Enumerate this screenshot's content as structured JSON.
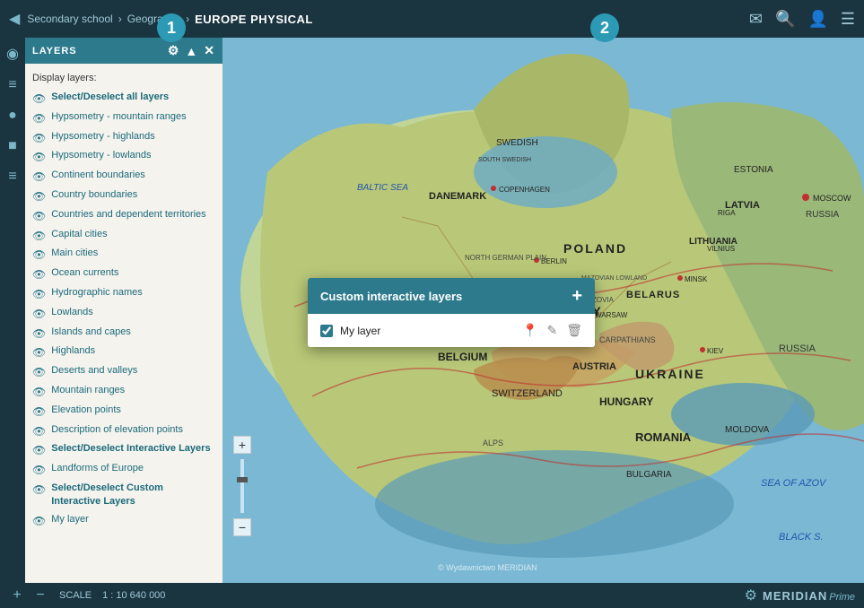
{
  "header": {
    "nav_back": "◀",
    "breadcrumb": {
      "part1": "Secondary school",
      "sep1": "›",
      "part2": "Geography",
      "sep2": "›",
      "current": "EUROPE PHYSICAL"
    },
    "icons": {
      "mail": "✉",
      "search": "🔍",
      "user": "👤",
      "menu": "☰"
    }
  },
  "left_toolbar": {
    "icons": [
      "◉",
      "≡",
      "📍",
      "⊞",
      "☰"
    ]
  },
  "sidebar": {
    "header_label": "LAYERS",
    "display_layers_label": "Display layers:",
    "layers": [
      {
        "text": "Select/Deselect all layers",
        "bold": true
      },
      {
        "text": "Hypsometry - mountain ranges"
      },
      {
        "text": "Hypsometry - highlands"
      },
      {
        "text": "Hypsometry - lowlands"
      },
      {
        "text": "Continent boundaries"
      },
      {
        "text": "Country boundaries"
      },
      {
        "text": "Countries and dependent territories"
      },
      {
        "text": "Capital cities"
      },
      {
        "text": "Main cities"
      },
      {
        "text": "Ocean currents"
      },
      {
        "text": "Hydrographic names"
      },
      {
        "text": "Lowlands"
      },
      {
        "text": "Islands and capes"
      },
      {
        "text": "Highlands"
      },
      {
        "text": "Deserts and valleys"
      },
      {
        "text": "Mountain ranges"
      },
      {
        "text": "Elevation points"
      },
      {
        "text": "Description of elevation points"
      },
      {
        "text": "Select/Deselect Interactive Layers",
        "bold": true
      },
      {
        "text": "Landforms of Europe"
      },
      {
        "text": "Select/Deselect Custom Interactive Layers",
        "bold": true
      },
      {
        "text": "My layer"
      }
    ]
  },
  "custom_layers_popup": {
    "title": "Custom interactive layers",
    "add_btn": "+",
    "layer": {
      "name": "My layer",
      "checked": true
    }
  },
  "bottom_bar": {
    "zoom_plus": "+",
    "zoom_minus": "−",
    "scale_label": "SCALE",
    "scale_value": "1 : 10 640 000",
    "meridian_text": "MERIDIAN",
    "prime_text": "Prime",
    "copyright": "© Wydawnictwo MERIDIAN"
  },
  "balloons": {
    "one": "1",
    "two": "2"
  },
  "popup_icons": {
    "location": "📍",
    "edit": "✏",
    "delete": "🗑"
  }
}
